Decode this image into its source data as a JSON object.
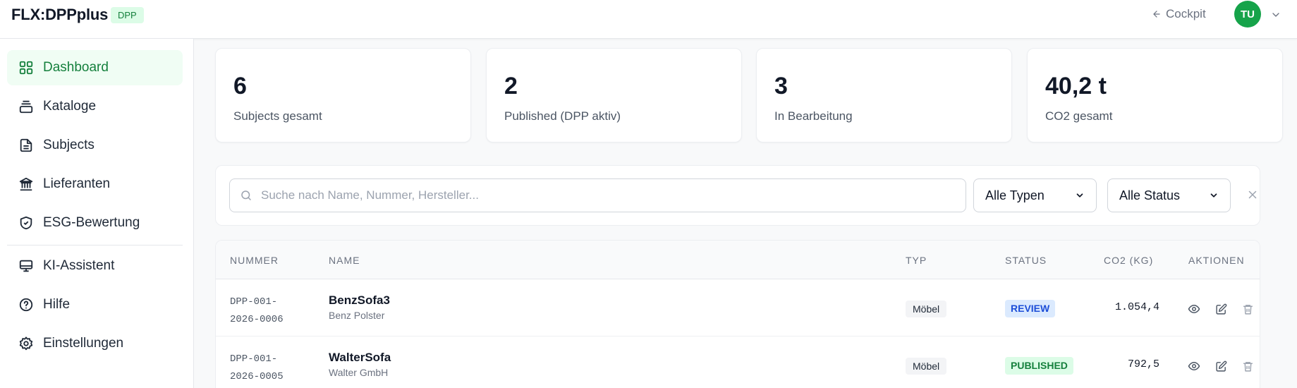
{
  "header": {
    "brand": "FLX:DPPplus",
    "badge": "DPP",
    "cockpit_label": "Cockpit",
    "avatar_initials": "TU"
  },
  "sidebar": {
    "items": [
      {
        "label": "Dashboard",
        "icon": "grid-icon",
        "active": true
      },
      {
        "label": "Kataloge",
        "icon": "stack-icon"
      },
      {
        "label": "Subjects",
        "icon": "document-icon"
      },
      {
        "label": "Lieferanten",
        "icon": "building-icon"
      },
      {
        "label": "ESG-Bewertung",
        "icon": "shield-check-icon"
      },
      {
        "label": "KI-Assistent",
        "icon": "monitor-icon"
      },
      {
        "label": "Hilfe",
        "icon": "help-circle-icon"
      },
      {
        "label": "Einstellungen",
        "icon": "gear-icon"
      }
    ]
  },
  "stats": [
    {
      "value": "6",
      "label": "Subjects gesamt"
    },
    {
      "value": "2",
      "label": "Published (DPP aktiv)"
    },
    {
      "value": "3",
      "label": "In Bearbeitung"
    },
    {
      "value": "40,2 t",
      "label": "CO2 gesamt"
    }
  ],
  "filters": {
    "search_placeholder": "Suche nach Name, Nummer, Hersteller...",
    "search_value": "",
    "type_selected": "Alle Typen",
    "status_selected": "Alle Status"
  },
  "table": {
    "columns": {
      "number": "NUMMER",
      "name": "NAME",
      "type": "TYP",
      "status": "STATUS",
      "co2": "CO2 (KG)",
      "actions": "AKTIONEN"
    },
    "rows": [
      {
        "number_line1": "DPP-001-",
        "number_line2": "2026-0006",
        "name": "BenzSofa3",
        "maker": "Benz Polster",
        "type": "Möbel",
        "status": "REVIEW",
        "co2": "1.054,4"
      },
      {
        "number_line1": "DPP-001-",
        "number_line2": "2026-0005",
        "name": "WalterSofa",
        "maker": "Walter GmbH",
        "type": "Möbel",
        "status": "PUBLISHED",
        "co2": "792,5"
      }
    ]
  },
  "colors": {
    "accent": "#16a34a",
    "review_bg": "#dbeafe",
    "review_fg": "#1d4ed8",
    "published_bg": "#dcfce7",
    "published_fg": "#15803d"
  }
}
